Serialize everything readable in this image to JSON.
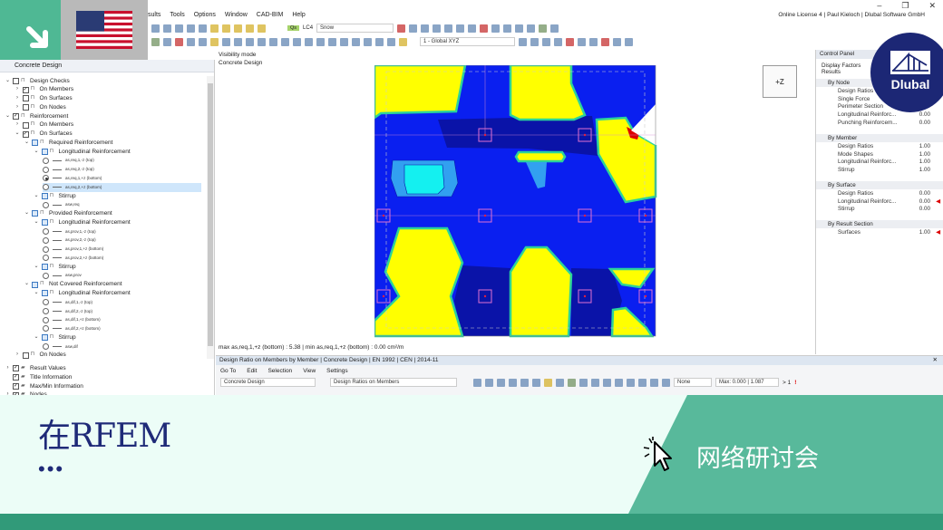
{
  "menu": [
    "sults",
    "Tools",
    "Options",
    "Window",
    "CAD-BIM",
    "Help"
  ],
  "license": "Online License 4 | Paul Kieloch | Dlubal Software GmbH",
  "window_controls": [
    "–",
    "❐",
    "✕"
  ],
  "toolbar": {
    "load_case_badge": "Qs",
    "load_case": "LC4",
    "load_name": "Snow",
    "coordinate_system": "1 - Global XYZ"
  },
  "left_panel": {
    "title": "Concrete Design",
    "tree": [
      {
        "d": 0,
        "t": "chk",
        "c": "",
        "l": "Design Checks",
        "x": "v"
      },
      {
        "d": 1,
        "t": "chk",
        "c": "✓",
        "l": "On Members",
        "x": ">"
      },
      {
        "d": 1,
        "t": "chk",
        "c": "",
        "l": "On Surfaces",
        "x": ">"
      },
      {
        "d": 1,
        "t": "chk",
        "c": "",
        "l": "On Nodes",
        "x": ">"
      },
      {
        "d": 0,
        "t": "chk",
        "c": "✓",
        "l": "Reinforcement",
        "x": "v"
      },
      {
        "d": 1,
        "t": "chk",
        "c": "",
        "l": "On Members",
        "x": ">"
      },
      {
        "d": 1,
        "t": "chk",
        "c": "✓",
        "l": "On Surfaces",
        "x": "v"
      },
      {
        "d": 2,
        "t": "blue",
        "l": "Required Reinforcement",
        "x": "v"
      },
      {
        "d": 3,
        "t": "blue",
        "l": "Longitudinal Reinforcement",
        "x": "v"
      },
      {
        "d": 4,
        "t": "rad",
        "l": "as,req,1,-z (top)"
      },
      {
        "d": 4,
        "t": "rad",
        "l": "as,req,2,-z (top)"
      },
      {
        "d": 4,
        "t": "rad",
        "on": true,
        "l": "as,req,1,+z (bottom)"
      },
      {
        "d": 4,
        "t": "rad",
        "hl": true,
        "l": "as,req,2,+z (bottom)"
      },
      {
        "d": 3,
        "t": "blue",
        "l": "Stirrup",
        "x": "v"
      },
      {
        "d": 4,
        "t": "rad",
        "l": "asw,req"
      },
      {
        "d": 2,
        "t": "blue",
        "l": "Provided Reinforcement",
        "x": "v"
      },
      {
        "d": 3,
        "t": "blue",
        "l": "Longitudinal Reinforcement",
        "x": "v"
      },
      {
        "d": 4,
        "t": "rad",
        "l": "as,prov,1,-z (top)"
      },
      {
        "d": 4,
        "t": "rad",
        "l": "as,prov,2,-z (top)"
      },
      {
        "d": 4,
        "t": "rad",
        "l": "as,prov,1,+z (bottom)"
      },
      {
        "d": 4,
        "t": "rad",
        "l": "as,prov,2,+z (bottom)"
      },
      {
        "d": 3,
        "t": "blue",
        "l": "Stirrup",
        "x": "v"
      },
      {
        "d": 4,
        "t": "rad",
        "l": "asw,prov"
      },
      {
        "d": 2,
        "t": "blue",
        "l": "Not Covered Reinforcement",
        "x": "v"
      },
      {
        "d": 3,
        "t": "blue",
        "l": "Longitudinal Reinforcement",
        "x": "v"
      },
      {
        "d": 4,
        "t": "rad",
        "l": "as,dif,1,-z (top)"
      },
      {
        "d": 4,
        "t": "rad",
        "l": "as,dif,2,-z (top)"
      },
      {
        "d": 4,
        "t": "rad",
        "l": "as,dif,1,+z (bottom)"
      },
      {
        "d": 4,
        "t": "rad",
        "l": "as,dif,2,+z (bottom)"
      },
      {
        "d": 3,
        "t": "blue",
        "l": "Stirrup",
        "x": "v"
      },
      {
        "d": 4,
        "t": "rad",
        "l": "asw,dif"
      },
      {
        "d": 1,
        "t": "chk",
        "c": "",
        "l": "On Nodes",
        "x": ">"
      }
    ],
    "bottom_tree": [
      {
        "c": "✓",
        "l": "Result Values",
        "x": ">"
      },
      {
        "c": "✓",
        "l": "Title Information",
        "x": ""
      },
      {
        "c": "✓",
        "l": "Max/Min Information",
        "x": ""
      },
      {
        "c": "✓",
        "l": "Nodes",
        "x": ">"
      }
    ]
  },
  "viewport": {
    "mode_label": "Visibility mode",
    "design_label": "Concrete Design",
    "view_cube": "+Z"
  },
  "status_line": "max as,req,1,+z (bottom) : 5.38 | min as,req,1,+z (bottom) : 0.00 cm²/m",
  "control_panel": {
    "title": "Control Panel",
    "tab1": "Display Factors",
    "tab2": "Results",
    "groups": [
      {
        "name": "By Node",
        "items": [
          {
            "l": "Design Ratios",
            "v": ""
          },
          {
            "l": "Single Force",
            "v": ""
          },
          {
            "l": "Perimeter Section",
            "v": ""
          },
          {
            "l": "Longitudinal Reinforc...",
            "v": "0.00"
          },
          {
            "l": "Punching Reinforcem...",
            "v": "0.00"
          }
        ]
      },
      {
        "name": "By Member",
        "items": [
          {
            "l": "Design Ratios",
            "v": "1.00"
          },
          {
            "l": "Mode Shapes",
            "v": "1.00"
          },
          {
            "l": "Longitudinal Reinforc...",
            "v": "1.00"
          },
          {
            "l": "Stirrup",
            "v": "1.00"
          }
        ]
      },
      {
        "name": "By Surface",
        "items": [
          {
            "l": "Design Ratios",
            "v": "0.00"
          },
          {
            "l": "Longitudinal Reinforc...",
            "v": "0.00",
            "m": true
          },
          {
            "l": "Stirrup",
            "v": "0.00"
          }
        ]
      },
      {
        "name": "By Result Section",
        "items": [
          {
            "l": "Surfaces",
            "v": "1.00",
            "m": true
          }
        ]
      }
    ]
  },
  "bottom_panel": {
    "title": "Design Ratio on Members by Member | Concrete Design | EN 1992 | CEN | 2014-11",
    "menu": [
      "Go To",
      "Edit",
      "Selection",
      "View",
      "Settings"
    ],
    "module": "Concrete Design",
    "table": "Design Ratios on Members",
    "filter": "None",
    "max": "Max: 0.000 | 1.087",
    "gt": "> 1"
  },
  "logo": "Dlubal",
  "banner": {
    "title": "在RFEM",
    "dots": "•••",
    "webinar": "网络研讨会"
  },
  "colors": {
    "green": "#4fb894",
    "dark_green": "#319a79",
    "mint": "#ecfdf7",
    "navy": "#1f2a78",
    "contour_blue": "#0a1ff0",
    "contour_yellow": "#ffff00"
  }
}
